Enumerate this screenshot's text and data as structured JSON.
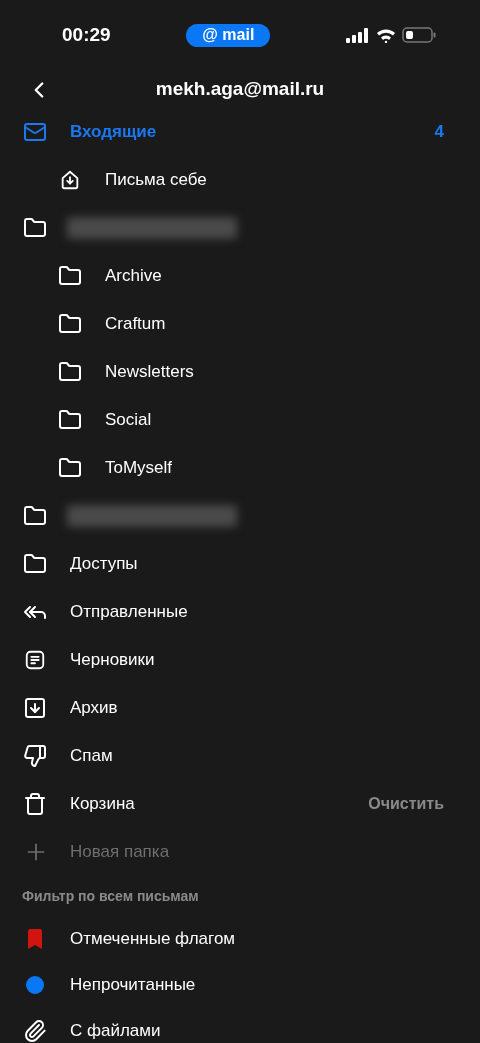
{
  "status_bar": {
    "time": "00:29",
    "app_pill": "@ mail"
  },
  "header": {
    "title": "mekh.aga@mail.ru"
  },
  "folders": [
    {
      "label": "Входящие",
      "kind": "mail",
      "selected": true,
      "count": "4",
      "children": [
        {
          "label": "Письма себе",
          "kind": "to-self",
          "selected": false
        }
      ]
    },
    {
      "redacted": true,
      "kind": "folder",
      "selected": false,
      "children": [
        {
          "label": "Archive",
          "kind": "folder",
          "selected": false
        },
        {
          "label": "Craftum",
          "kind": "folder",
          "selected": false
        },
        {
          "label": "Newsletters",
          "kind": "folder",
          "selected": false
        },
        {
          "label": "Social",
          "kind": "folder",
          "selected": false
        },
        {
          "label": "ToMyself",
          "kind": "folder",
          "selected": false
        }
      ]
    },
    {
      "redacted": true,
      "kind": "folder",
      "selected": false
    },
    {
      "label": "Доступы",
      "kind": "folder",
      "selected": false
    },
    {
      "label": "Отправленные",
      "kind": "sent",
      "selected": false
    },
    {
      "label": "Черновики",
      "kind": "drafts",
      "selected": false
    },
    {
      "label": "Архив",
      "kind": "archive",
      "selected": false
    },
    {
      "label": "Спам",
      "kind": "spam",
      "selected": false
    },
    {
      "label": "Корзина",
      "kind": "trash",
      "selected": false,
      "action": "Очистить"
    }
  ],
  "new_folder": {
    "label": "Новая папка",
    "disabled": true
  },
  "filter_section": {
    "title": "Фильтр по всем письмам",
    "items": [
      {
        "label": "Отмеченные флагом",
        "kind": "flag",
        "color": "#d0150f"
      },
      {
        "label": "Непрочитанные",
        "kind": "dot",
        "color": "#0a77f5"
      },
      {
        "label": "С файлами",
        "kind": "clip"
      }
    ]
  }
}
